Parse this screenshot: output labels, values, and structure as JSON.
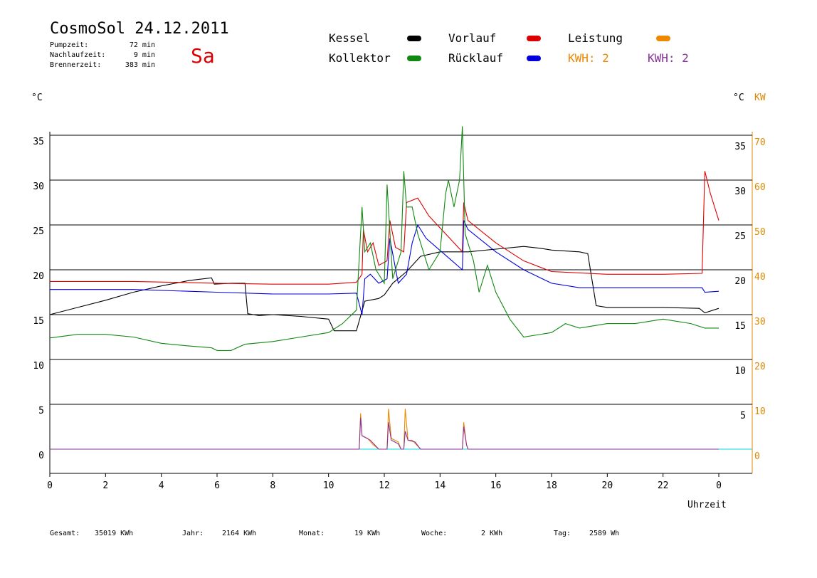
{
  "header": {
    "title": "CosmoSol 24.12.2011",
    "day": "Sa",
    "stats": [
      {
        "label": "Pumpzeit:",
        "value": "72 min"
      },
      {
        "label": "Nachlaufzeit:",
        "value": "9 min"
      },
      {
        "label": "Brennerzeit:",
        "value": "383 min"
      }
    ]
  },
  "legend": [
    {
      "label": "Kessel",
      "color": "#000000"
    },
    {
      "label": "Vorlauf",
      "color": "#dd0000"
    },
    {
      "label": "Leistung",
      "color": "#ee8800"
    },
    {
      "label": "Kollektor",
      "color": "#118811"
    },
    {
      "label": "Rücklauf",
      "color": "#0000dd"
    },
    {
      "label": "KWH: 2",
      "color": "#ee8800"
    },
    {
      "label": "KWH: 2",
      "color": "#883399"
    }
  ],
  "footer": [
    {
      "label": "Gesamt:",
      "value": "35019 KWh"
    },
    {
      "label": "Jahr:",
      "value": "2164 KWh"
    },
    {
      "label": "Monat:",
      "value": "19 KWh"
    },
    {
      "label": "Woche:",
      "value": "2 KWh"
    },
    {
      "label": "Tag:",
      "value": "2589 Wh"
    }
  ],
  "chart_data": {
    "type": "line",
    "xlabel": "Uhrzeit",
    "ylabel_left": "°C",
    "ylabel_right_temp": "°C",
    "ylabel_right_power": "KW",
    "xlim": [
      0,
      24
    ],
    "ylim": [
      -2,
      36
    ],
    "grid": true,
    "x_ticks": [
      0,
      2,
      4,
      6,
      8,
      10,
      12,
      14,
      16,
      18,
      20,
      22,
      24
    ],
    "x_tick_labels": [
      "0",
      "2",
      "4",
      "6",
      "8",
      "10",
      "12",
      "14",
      "16",
      "18",
      "20",
      "22",
      "0"
    ],
    "y_ticks": [
      0,
      5,
      10,
      15,
      20,
      25,
      30,
      35
    ],
    "y_tick_labels_left": [
      "0",
      "5",
      "10",
      "15",
      "20",
      "25",
      "30",
      "35"
    ],
    "y_tick_labels_right": [
      "",
      "5",
      "10",
      "15",
      "20",
      "25",
      "30",
      "35"
    ],
    "y_tick_labels_power": [
      "0",
      "10",
      "20",
      "30",
      "40",
      "50",
      "60",
      "70"
    ],
    "series": [
      {
        "name": "Kessel",
        "color": "#000000",
        "points": [
          [
            0,
            15
          ],
          [
            1,
            15.8
          ],
          [
            2,
            16.6
          ],
          [
            3,
            17.5
          ],
          [
            4,
            18.2
          ],
          [
            5,
            18.8
          ],
          [
            5.8,
            19.1
          ],
          [
            5.9,
            18.4
          ],
          [
            6.5,
            18.5
          ],
          [
            7.0,
            18.5
          ],
          [
            7.1,
            15.1
          ],
          [
            7.5,
            14.9
          ],
          [
            8,
            15.0
          ],
          [
            9,
            14.8
          ],
          [
            10,
            14.5
          ],
          [
            10.2,
            13.2
          ],
          [
            11,
            13.2
          ],
          [
            11.3,
            16.5
          ],
          [
            11.8,
            16.8
          ],
          [
            12.0,
            17.2
          ],
          [
            12.3,
            18.5
          ],
          [
            12.8,
            19.8
          ],
          [
            13.3,
            21.5
          ],
          [
            14,
            22.0
          ],
          [
            15,
            22.0
          ],
          [
            16,
            22.3
          ],
          [
            17,
            22.6
          ],
          [
            17.6,
            22.4
          ],
          [
            18,
            22.2
          ],
          [
            19,
            22.0
          ],
          [
            19.3,
            21.8
          ],
          [
            19.6,
            16.0
          ],
          [
            20,
            15.8
          ],
          [
            21,
            15.8
          ],
          [
            22,
            15.8
          ],
          [
            23.3,
            15.7
          ],
          [
            23.5,
            15.2
          ],
          [
            24,
            15.7
          ]
        ]
      },
      {
        "name": "Vorlauf",
        "color": "#dd0000",
        "points": [
          [
            0,
            18.7
          ],
          [
            3,
            18.7
          ],
          [
            6,
            18.5
          ],
          [
            8,
            18.4
          ],
          [
            10,
            18.4
          ],
          [
            11.0,
            18.6
          ],
          [
            11.2,
            19.5
          ],
          [
            11.25,
            24.5
          ],
          [
            11.4,
            22.0
          ],
          [
            11.6,
            23.0
          ],
          [
            11.8,
            20.5
          ],
          [
            12.1,
            21.0
          ],
          [
            12.2,
            25.5
          ],
          [
            12.4,
            22.5
          ],
          [
            12.7,
            22.0
          ],
          [
            12.8,
            27.5
          ],
          [
            13.2,
            28.0
          ],
          [
            13.6,
            26.0
          ],
          [
            14.8,
            22.0
          ],
          [
            14.85,
            27.5
          ],
          [
            15,
            25.5
          ],
          [
            16,
            23.0
          ],
          [
            17,
            21.0
          ],
          [
            18,
            19.8
          ],
          [
            20,
            19.5
          ],
          [
            22,
            19.5
          ],
          [
            23.4,
            19.6
          ],
          [
            23.5,
            31
          ],
          [
            23.7,
            28.5
          ],
          [
            24,
            25.5
          ]
        ]
      },
      {
        "name": "Rücklauf",
        "color": "#0000dd",
        "points": [
          [
            0,
            17.8
          ],
          [
            3,
            17.8
          ],
          [
            6,
            17.5
          ],
          [
            8,
            17.3
          ],
          [
            10,
            17.3
          ],
          [
            11.0,
            17.4
          ],
          [
            11.2,
            15.0
          ],
          [
            11.3,
            19.0
          ],
          [
            11.5,
            19.5
          ],
          [
            11.8,
            18.5
          ],
          [
            12.1,
            19.0
          ],
          [
            12.2,
            23.5
          ],
          [
            12.5,
            18.5
          ],
          [
            12.8,
            19.5
          ],
          [
            13.0,
            23.0
          ],
          [
            13.2,
            25.0
          ],
          [
            13.5,
            23.5
          ],
          [
            14.8,
            20.0
          ],
          [
            14.85,
            25.5
          ],
          [
            15,
            24.5
          ],
          [
            16,
            22.0
          ],
          [
            17,
            20.0
          ],
          [
            18,
            18.5
          ],
          [
            19,
            18.0
          ],
          [
            20,
            18.0
          ],
          [
            22,
            18.0
          ],
          [
            23.4,
            18.0
          ],
          [
            23.5,
            17.5
          ],
          [
            24,
            17.6
          ]
        ]
      },
      {
        "name": "Kollektor",
        "color": "#118811",
        "points": [
          [
            0,
            12.4
          ],
          [
            1,
            12.8
          ],
          [
            2,
            12.8
          ],
          [
            3,
            12.5
          ],
          [
            4,
            11.8
          ],
          [
            5,
            11.5
          ],
          [
            5.8,
            11.3
          ],
          [
            6,
            11.0
          ],
          [
            6.5,
            11.0
          ],
          [
            7,
            11.7
          ],
          [
            8,
            12.0
          ],
          [
            9,
            12.5
          ],
          [
            10,
            13.0
          ],
          [
            10.5,
            14.0
          ],
          [
            11.0,
            15.5
          ],
          [
            11.2,
            27.0
          ],
          [
            11.3,
            22.0
          ],
          [
            11.5,
            23.0
          ],
          [
            11.7,
            20.0
          ],
          [
            12.0,
            18.5
          ],
          [
            12.1,
            29.5
          ],
          [
            12.3,
            19.0
          ],
          [
            12.6,
            22.0
          ],
          [
            12.7,
            31.0
          ],
          [
            12.8,
            27.0
          ],
          [
            13.0,
            27.0
          ],
          [
            13.2,
            24.0
          ],
          [
            13.6,
            20.0
          ],
          [
            14.0,
            22.0
          ],
          [
            14.2,
            28.5
          ],
          [
            14.3,
            30.0
          ],
          [
            14.5,
            27.0
          ],
          [
            14.7,
            30.0
          ],
          [
            14.8,
            36.0
          ],
          [
            14.9,
            24.0
          ],
          [
            15.2,
            21.0
          ],
          [
            15.4,
            17.5
          ],
          [
            15.7,
            20.5
          ],
          [
            16,
            17.5
          ],
          [
            16.5,
            14.5
          ],
          [
            17,
            12.5
          ],
          [
            18,
            13.0
          ],
          [
            18.5,
            14.0
          ],
          [
            19,
            13.5
          ],
          [
            20,
            14.0
          ],
          [
            21,
            14.0
          ],
          [
            22,
            14.5
          ],
          [
            23,
            14.0
          ],
          [
            23.5,
            13.5
          ],
          [
            24,
            13.5
          ]
        ]
      },
      {
        "name": "Leistung",
        "color": "#ee8800",
        "points": [
          [
            0,
            0
          ],
          [
            11.1,
            0
          ],
          [
            11.15,
            4
          ],
          [
            11.2,
            1.5
          ],
          [
            11.4,
            1.2
          ],
          [
            11.6,
            0.5
          ],
          [
            11.8,
            0
          ],
          [
            12.1,
            0
          ],
          [
            12.15,
            4.5
          ],
          [
            12.25,
            1.2
          ],
          [
            12.5,
            0.8
          ],
          [
            12.6,
            0
          ],
          [
            12.7,
            0
          ],
          [
            12.75,
            4.5
          ],
          [
            12.85,
            1.0
          ],
          [
            13.0,
            1.0
          ],
          [
            13.3,
            0
          ],
          [
            14.8,
            0
          ],
          [
            14.85,
            3.0
          ],
          [
            14.95,
            0.5
          ],
          [
            15.0,
            0
          ],
          [
            24,
            0
          ]
        ]
      },
      {
        "name": "KWH",
        "color": "#883399",
        "points": [
          [
            0,
            0
          ],
          [
            11.1,
            0
          ],
          [
            11.15,
            3.5
          ],
          [
            11.2,
            1.5
          ],
          [
            11.5,
            1.0
          ],
          [
            11.8,
            0
          ],
          [
            12.1,
            0
          ],
          [
            12.15,
            3.0
          ],
          [
            12.25,
            1.0
          ],
          [
            12.5,
            0.6
          ],
          [
            12.6,
            0
          ],
          [
            12.7,
            0
          ],
          [
            12.75,
            2.0
          ],
          [
            12.85,
            1.0
          ],
          [
            13.1,
            0.8
          ],
          [
            13.3,
            0
          ],
          [
            14.8,
            0
          ],
          [
            14.85,
            2.5
          ],
          [
            14.95,
            0.5
          ],
          [
            15.0,
            0
          ],
          [
            24,
            0
          ]
        ]
      }
    ]
  }
}
